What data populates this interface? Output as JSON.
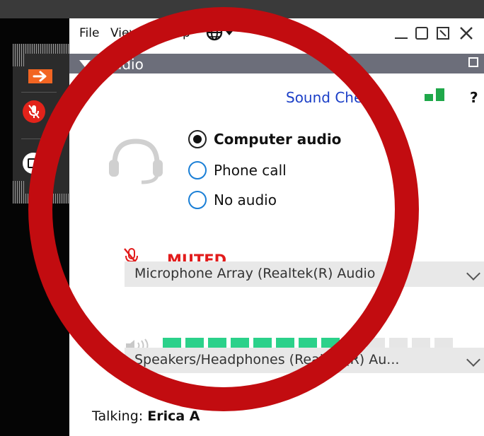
{
  "menu": {
    "file": "File",
    "view": "View",
    "help": "Help"
  },
  "section": {
    "title": "Audio"
  },
  "sound_check": "Sound Check",
  "help_glyph": "?",
  "audio_options": [
    {
      "label": "Computer audio",
      "selected": true
    },
    {
      "label": "Phone call",
      "selected": false
    },
    {
      "label": "No audio",
      "selected": false
    }
  ],
  "mute_status": "MUTED",
  "microphone": {
    "selected": "Microphone Array (Realtek(R) Audio"
  },
  "speaker": {
    "selected": "Speakers/Headphones (Realtek(R) Au..."
  },
  "speaker_level": {
    "active_segments": 8,
    "total_segments": 13
  },
  "talking": {
    "label": "Talking:",
    "name": "Erica A"
  },
  "colors": {
    "accent_orange": "#f26522",
    "mute_red": "#e2231a",
    "link_blue": "#1b3fc7",
    "meter_green": "#2bd18a",
    "annotation_circle": "#c20c10"
  },
  "icons": [
    "arrow-right-icon",
    "muted-mic-icon",
    "camera-icon",
    "globe-icon",
    "headset-icon",
    "speaker-icon",
    "signal-icon",
    "help-icon"
  ]
}
